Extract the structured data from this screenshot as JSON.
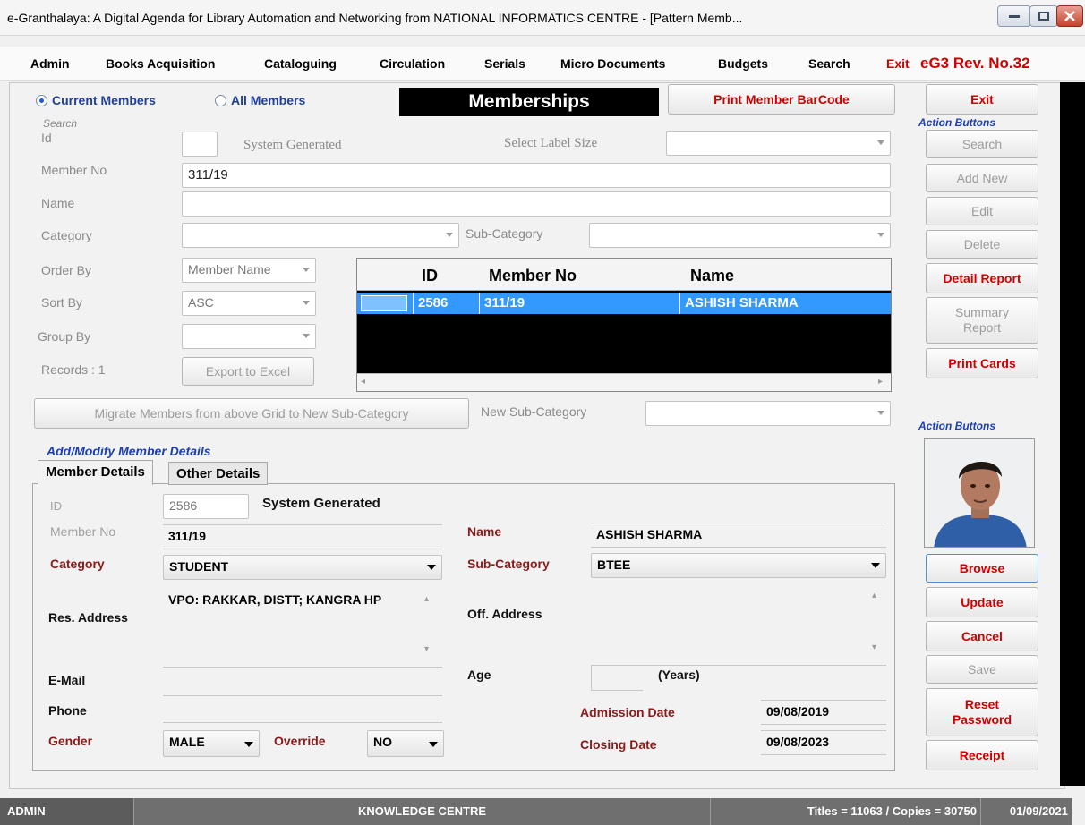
{
  "window": {
    "title": "e-Granthalaya: A Digital Agenda for Library Automation and Networking from NATIONAL INFORMATICS CENTRE - [Pattern Memb..."
  },
  "menu": {
    "items": [
      "Admin",
      "Books Acquisition",
      "Cataloguing",
      "Circulation",
      "Serials",
      "Micro Documents",
      "Budgets",
      "Search"
    ],
    "exit_label": "Exit",
    "revision": "eG3 Rev. No.32"
  },
  "filter": {
    "current_members_label": "Current Members",
    "all_members_label": "All Members",
    "selected": "current"
  },
  "page_title": "Memberships",
  "print_barcode_label": "Print Member BarCode",
  "search": {
    "section_label": "Search",
    "id_label": "Id",
    "id_value": "",
    "system_generated": "System Generated",
    "label_size_label": "Select Label Size",
    "label_size_value": "",
    "member_no_label": "Member No",
    "member_no_value": "311/19",
    "name_label": "Name",
    "name_value": "",
    "category_label": "Category",
    "category_value": "",
    "sub_category_label": "Sub-Category",
    "sub_category_value": "",
    "order_by_label": "Order By",
    "order_by_value": "Member Name",
    "sort_by_label": "Sort By",
    "sort_by_value": "ASC",
    "group_by_label": "Group By",
    "group_by_value": "",
    "records_label": "Records : 1",
    "export_label": "Export to Excel"
  },
  "grid": {
    "columns": [
      "ID",
      "Member No",
      "Name"
    ],
    "rows": [
      {
        "id": "2586",
        "member_no": "311/19",
        "name": "ASHISH SHARMA"
      }
    ]
  },
  "migrate": {
    "button_label": "Migrate Members from above Grid to New Sub-Category",
    "new_sub_category_label": "New Sub-Category",
    "new_sub_category_value": ""
  },
  "details": {
    "section_label": "Add/Modify Member Details",
    "tabs": [
      "Member Details",
      "Other Details"
    ],
    "id_label": "ID",
    "id_value": "2586",
    "system_generated": "System Generated",
    "member_no_label": "Member No",
    "member_no_value": "311/19",
    "name_label": "Name",
    "name_value": "ASHISH SHARMA",
    "category_label": "Category",
    "category_value": "STUDENT",
    "sub_category_label": "Sub-Category",
    "sub_category_value": "BTEE",
    "res_address_label": "Res. Address",
    "res_address_value": "VPO: RAKKAR, DISTT; KANGRA HP",
    "off_address_label": "Off. Address",
    "off_address_value": "",
    "email_label": "E-Mail",
    "email_value": "",
    "age_label": "Age",
    "age_value": "",
    "years_label": "(Years)",
    "phone_label": "Phone",
    "phone_value": "",
    "admission_date_label": "Admission Date",
    "admission_date_value": "09/08/2019",
    "gender_label": "Gender",
    "gender_value": "MALE",
    "override_label": "Override",
    "override_value": "NO",
    "closing_date_label": "Closing Date",
    "closing_date_value": "09/08/2023"
  },
  "actions_top": {
    "exit": "Exit",
    "section_label": "Action Buttons",
    "search": "Search",
    "add_new": "Add New",
    "edit": "Edit",
    "delete": "Delete",
    "detail_report": "Detail Report",
    "summary_report_line1": "Summary",
    "summary_report_line2": "Report",
    "print_cards": "Print Cards"
  },
  "actions_bottom": {
    "section_label": "Action Buttons",
    "browse": "Browse",
    "update": "Update",
    "cancel": "Cancel",
    "save": "Save",
    "reset_line1": "Reset",
    "reset_line2": "Password",
    "receipt": "Receipt"
  },
  "status": {
    "user": "ADMIN",
    "centre": "KNOWLEDGE CENTRE",
    "counts": "Titles = 11063 / Copies = 30750",
    "date": "01/09/2021"
  },
  "colors": {
    "accent_red": "#d10000",
    "selection_blue": "#3399ff",
    "label_dark_red": "#8b1a1a",
    "section_blue": "#1a3fb3"
  }
}
